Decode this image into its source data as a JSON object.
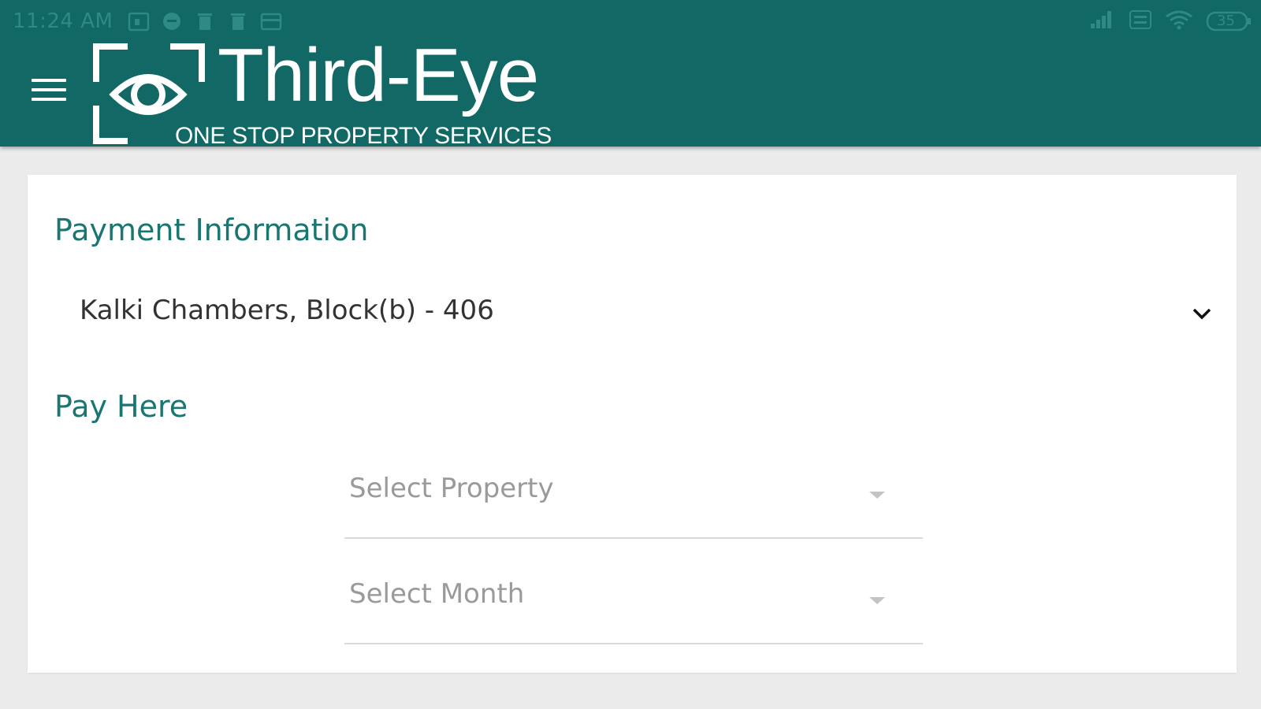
{
  "status_bar": {
    "time": "11:24 AM",
    "battery": "35"
  },
  "header": {
    "menu_icon": "hamburger-menu-icon",
    "logo_icon": "eye-frame-icon",
    "app_title": "Third-Eye",
    "tagline": "ONE STOP PROPERTY SERVICES",
    "brand_color": "#116864"
  },
  "payment_info": {
    "title": "Payment Information",
    "selected_property": "Kalki Chambers, Block(b) - 406"
  },
  "pay_here": {
    "title": "Pay Here",
    "property_placeholder": "Select Property",
    "month_placeholder": "Select Month"
  }
}
